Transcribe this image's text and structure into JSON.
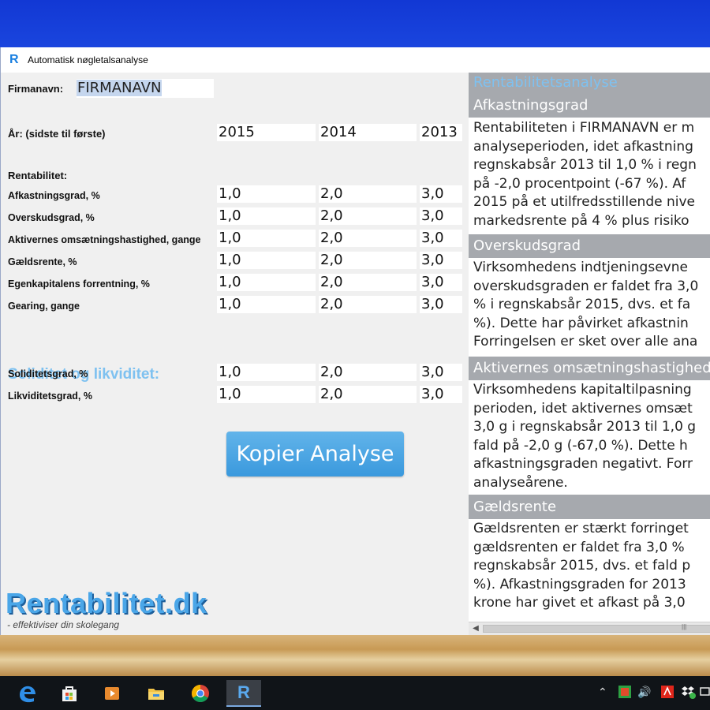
{
  "window": {
    "title": "Automatisk nøgletalsanalyse"
  },
  "form": {
    "firmanavn_label": "Firmanavn:",
    "firmanavn_value": "FIRMANAVN",
    "year_label": "År: (sidste til første)",
    "years": [
      "2015",
      "2014",
      "2013"
    ],
    "rentabilitet_label": "Rentabilitet:",
    "rentabilitet_rows": [
      {
        "label": "Afkastningsgrad, %",
        "values": [
          "1,0",
          "2,0",
          "3,0"
        ]
      },
      {
        "label": "Overskudsgrad, %",
        "values": [
          "1,0",
          "2,0",
          "3,0"
        ]
      },
      {
        "label": "Aktivernes omsætningshastighed, gange",
        "values": [
          "1,0",
          "2,0",
          "3,0"
        ]
      },
      {
        "label": "Gældsrente, %",
        "values": [
          "1,0",
          "2,0",
          "3,0"
        ]
      },
      {
        "label": "Egenkapitalens forrentning, %",
        "values": [
          "1,0",
          "2,0",
          "3,0"
        ]
      },
      {
        "label": "Gearing, gange",
        "values": [
          "1,0",
          "2,0",
          "3,0"
        ]
      }
    ],
    "soliditet_title": "Soliditet og likviditet:",
    "soliditet_rows": [
      {
        "label": "Soliditetsgrad, %",
        "values": [
          "1,0",
          "2,0",
          "3,0"
        ]
      },
      {
        "label": "Likviditetsgrad, %",
        "values": [
          "1,0",
          "2,0",
          "3,0"
        ]
      }
    ],
    "copy_button": "Kopier Analyse",
    "logo_text": "Rentabilitet.dk",
    "logo_tagline": "- effektiviser din skolegang"
  },
  "analysis": {
    "title": "Rentabilitetsanalyse",
    "sections": [
      {
        "heading": "Afkastningsgrad",
        "lines": [
          "Rentabiliteten i FIRMANAVN er m",
          "analyseperioden, idet afkastning",
          "regnskabsår 2013 til 1,0 % i regn",
          "på -2,0 procentpoint (-67 %). Af",
          "2015 på et utilfredsstillende nive",
          "markedsrente på 4 % plus risiko"
        ]
      },
      {
        "heading": "Overskudsgrad",
        "lines": [
          "Virksomhedens indtjeningsevne",
          "overskudsgraden er faldet fra 3,0",
          "% i regnskabsår 2015, dvs. et fa",
          "%). Dette har påvirket afkastnin",
          "Forringelsen er sket over alle ana"
        ]
      },
      {
        "heading": "Aktivernes omsætningshastighed",
        "lines": [
          "Virksomhedens kapitaltilpasning",
          "perioden, idet aktivernes omsæt",
          "3,0 g i regnskabsår 2013 til 1,0 g",
          "fald på -2,0 g (-67,0 %). Dette h",
          "afkastningsgraden negativt. Forr",
          "analyseårene."
        ]
      },
      {
        "heading": "Gældsrente",
        "lines": [
          "Gældsrenten er stærkt forringet",
          "gældsrenten er faldet fra 3,0 %",
          "regnskabsår 2015, dvs. et fald p",
          "%). Afkastningsgraden for 2013",
          "krone har givet et afkast på 3,0"
        ]
      }
    ]
  },
  "taskbar": {
    "apps": [
      "edge-icon",
      "store-icon",
      "media-icon",
      "explorer-icon",
      "chrome-icon",
      "rentabilitet-icon"
    ],
    "colors": {
      "bar": "#101418",
      "active": "#3a3f46"
    }
  },
  "colors": {
    "accent_blue": "#7ec1f0",
    "button_blue": "#3a99dd",
    "panel_header": "#a6a9ae"
  }
}
